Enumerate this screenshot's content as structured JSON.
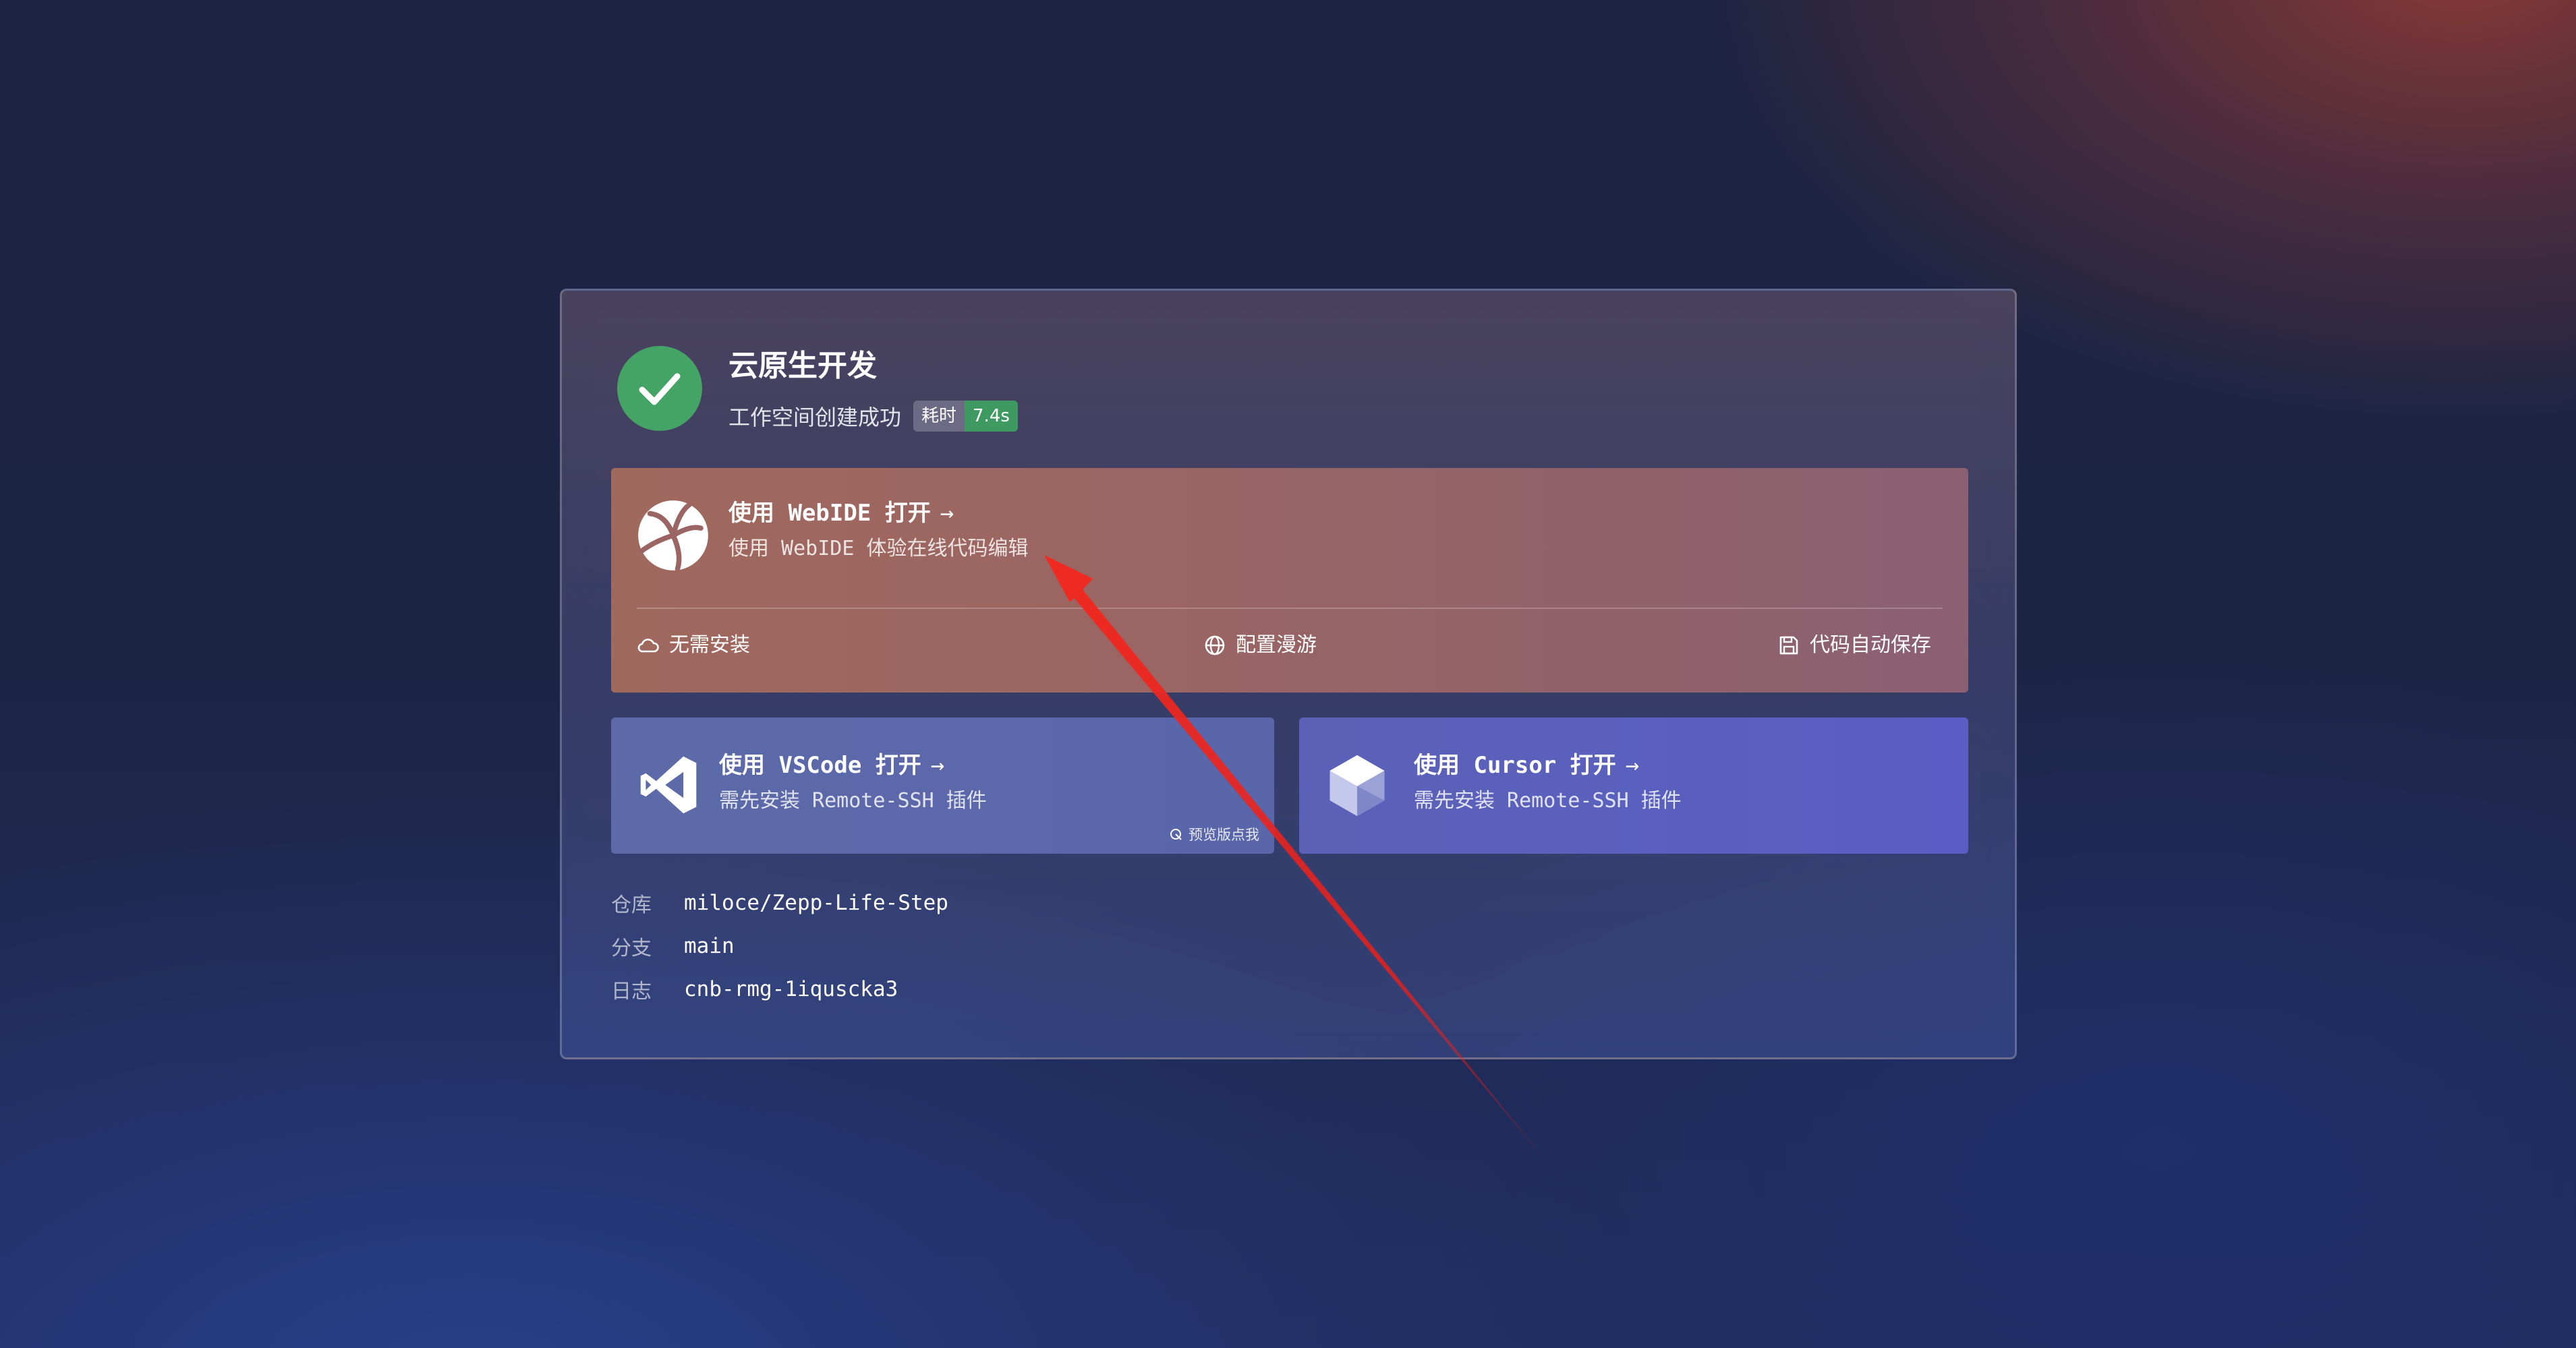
{
  "header": {
    "title": "云原生开发",
    "subtitle": "工作空间创建成功",
    "badge_key": "耗时",
    "badge_value": "7.4s",
    "status_icon": "check-circle-icon",
    "status_color": "#44a466"
  },
  "webide": {
    "title": "使用 WebIDE 打开",
    "arrow": "→",
    "description": "使用 WebIDE 体验在线代码编辑",
    "features": [
      {
        "icon": "cloud-icon",
        "label": "无需安装"
      },
      {
        "icon": "globe-icon",
        "label": "配置漫游"
      },
      {
        "icon": "save-icon",
        "label": "代码自动保存"
      }
    ]
  },
  "vscode": {
    "title": "使用 VSCode 打开",
    "arrow": "→",
    "description": "需先安装 Remote-SSH 插件",
    "preview_hint": "预览版点我"
  },
  "cursor": {
    "title": "使用 Cursor 打开",
    "arrow": "→",
    "description": "需先安装 Remote-SSH 插件"
  },
  "info": {
    "repo_label": "仓库",
    "repo_value": "miloce/Zepp-Life-Step",
    "branch_label": "分支",
    "branch_value": "main",
    "log_label": "日志",
    "log_value": "cnb-rmg-1iqusckа3"
  },
  "colors": {
    "accent_green": "#44a466",
    "annotation_red": "#e8201c"
  }
}
